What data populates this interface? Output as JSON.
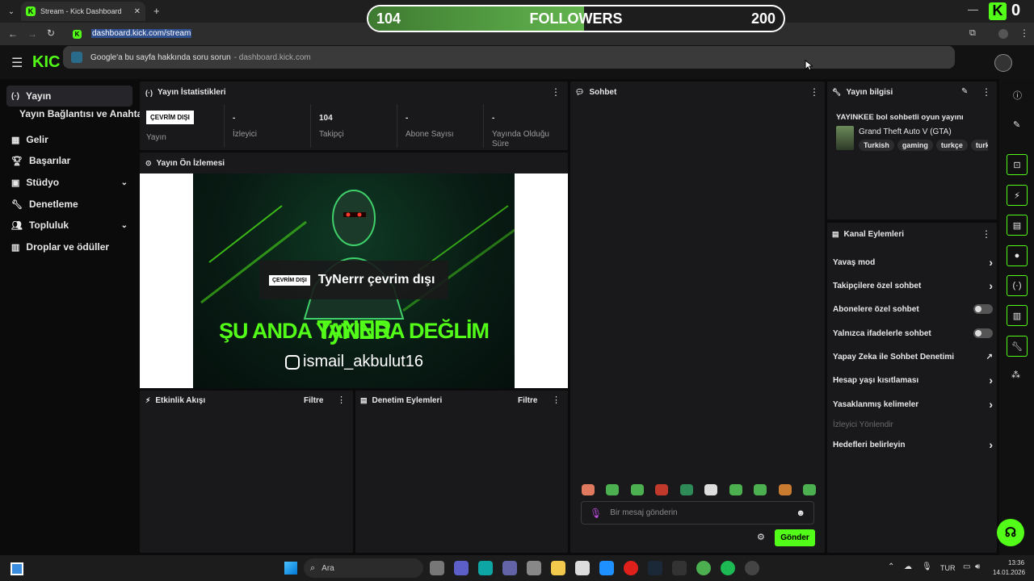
{
  "browser": {
    "tab_title": "Stream - Kick Dashboard",
    "url": "dashboard.kick.com/stream",
    "suggestion_text": "Google'a bu sayfa hakkında soru sorun",
    "suggestion_domain": "- dashboard.kick.com"
  },
  "overlay": {
    "followers_current": "104",
    "followers_label": "FOLLOWERS",
    "followers_goal": "200",
    "followers_progress": 0.52,
    "kick_badge_letter": "K",
    "kick_badge_count": "0"
  },
  "sidebar": {
    "items": [
      {
        "label": "Yayın",
        "icon": "broadcast-icon"
      },
      {
        "label": "Yayın Bağlantısı ve Anahtarı",
        "icon": ""
      },
      {
        "label": "Gelir",
        "icon": "revenue-icon"
      },
      {
        "label": "Başarılar",
        "icon": "trophy-icon"
      },
      {
        "label": "Stüdyo",
        "icon": "studio-icon"
      },
      {
        "label": "Denetleme",
        "icon": "wrench-icon"
      },
      {
        "label": "Topluluk",
        "icon": "community-icon"
      },
      {
        "label": "Droplar ve ödüller",
        "icon": "drops-icon"
      }
    ]
  },
  "stats": {
    "title": "Yayın İstatistikleri",
    "status_badge": "ÇEVRİM DIŞI",
    "status_label": "Yayın",
    "viewers_value": "-",
    "viewers_label": "İzleyici",
    "followers_value": "104",
    "followers_label": "Takipçi",
    "subs_value": "-",
    "subs_label": "Abone Sayısı",
    "live_value": "-",
    "live_label": "Yayında Olduğu Süre"
  },
  "preview": {
    "title": "Yayın Ön İzlemesi",
    "offline_badge": "ÇEVRİM DIŞI",
    "offline_text": "TyNerrr çevrim dışı",
    "banner_line1": "ŞU ANDA YAYINDA DEĞLİM",
    "banner_line2": "ismail_akbulut16",
    "banner_logo": "TyNER"
  },
  "activity": {
    "title": "Etkinlik Akışı",
    "filter": "Filtre"
  },
  "modlog": {
    "title": "Denetim Eylemleri",
    "filter": "Filtre"
  },
  "chat": {
    "title": "Sohbet",
    "placeholder": "Bir mesaj gönderin",
    "send": "Gönder"
  },
  "info": {
    "title": "Yayın bilgisi",
    "stream_title": "YAYINKEE bol sohbetli oyun yayını",
    "game": "Grand Theft Auto V (GTA)",
    "tags": [
      "Turkish",
      "gaming",
      "turkçe",
      "turkçey"
    ]
  },
  "channel": {
    "title": "Kanal Eylemleri",
    "items": [
      {
        "label": "Yavaş mod",
        "control": "chevron"
      },
      {
        "label": "Takipçilere özel sohbet",
        "control": "chevron"
      },
      {
        "label": "Abonelere özel sohbet",
        "control": "toggle"
      },
      {
        "label": "Yalnızca ifadelerle sohbet",
        "control": "toggle"
      },
      {
        "label": "Yapay Zeka ile Sohbet Denetimi",
        "control": "external"
      },
      {
        "label": "Hesap yaşı kısıtlaması",
        "control": "chevron"
      },
      {
        "label": "Yasaklanmış kelimeler",
        "control": "chevron"
      },
      {
        "label": "İzleyici Yönlendir",
        "control": "disabled"
      },
      {
        "label": "Hedefleri belirleyin",
        "control": "chevron"
      }
    ]
  },
  "taskbar": {
    "search": "Ara",
    "lang": "TUR",
    "time": "13:36",
    "date": "14.01.2026"
  },
  "colors": {
    "accent": "#53fc18",
    "panel": "#19191b",
    "background": "#0b0b0c"
  }
}
